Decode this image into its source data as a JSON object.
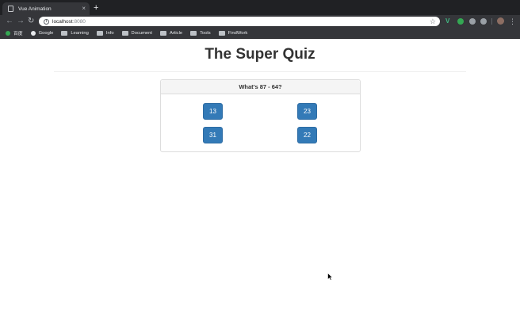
{
  "browser": {
    "tab_title": "Vue Animation",
    "tab_close": "×",
    "new_tab": "+",
    "back": "←",
    "forward": "→",
    "reload": "↻",
    "url_host": "localhost",
    "url_port": ":8080",
    "star": "☆",
    "menu": "⋮",
    "bookmarks": [
      {
        "label": "百度",
        "icon": "baidu-icon"
      },
      {
        "label": "Google",
        "icon": "google-icon"
      },
      {
        "label": "Learning",
        "icon": "folder-icon"
      },
      {
        "label": "Info",
        "icon": "folder-icon"
      },
      {
        "label": "Document",
        "icon": "folder-icon"
      },
      {
        "label": "Article",
        "icon": "folder-icon"
      },
      {
        "label": "Tools",
        "icon": "folder-icon"
      },
      {
        "label": "FindWork",
        "icon": "folder-icon"
      }
    ]
  },
  "app": {
    "title": "The Super Quiz",
    "question": "What's 87 - 64?",
    "answers": [
      "13",
      "23",
      "31",
      "22"
    ]
  },
  "colors": {
    "primary_button": "#337ab7",
    "panel_heading_bg": "#f5f5f5",
    "chrome_dark": "#35363a"
  }
}
